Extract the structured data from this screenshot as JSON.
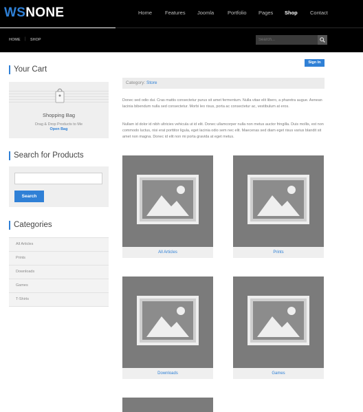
{
  "brand": {
    "part1": "WS",
    "part2": "NONE",
    "accent": "#2f80d6"
  },
  "nav": {
    "items": [
      "Home",
      "Features",
      "Joomla",
      "Portfolio",
      "Pages",
      "Shop",
      "Contact"
    ],
    "active": "Shop"
  },
  "breadcrumb": {
    "home": "HOME",
    "current": "SHOP"
  },
  "top_search": {
    "placeholder": "Search...",
    "icon": "search-icon"
  },
  "sidebar": {
    "cart": {
      "heading": "Your Cart",
      "icon": "shopping-bag-icon",
      "title": "Shopping Bag",
      "subtitle": "Drag & Drop Products to Me",
      "link": "Open Bag"
    },
    "search": {
      "heading": "Search for Products",
      "value": "",
      "button": "Search"
    },
    "categories": {
      "heading": "Categories",
      "items": [
        "All Articles",
        "Prints",
        "Downloads",
        "Games",
        "T-Shirts"
      ]
    }
  },
  "main": {
    "signin": "Sign In",
    "category_label": "Category:",
    "category_value": "Store",
    "paragraph1": "Donec sed odio dui. Cras mattis consectetur purus sit amet fermentum. Nulla vitae elit libero, a pharetra augue. Aenean lacinia bibendum nulla sed consectetur. Morbi leo risus, porta ac consectetur ac, vestibulum at eros.",
    "paragraph2": "Nullam id dolor id nibh ultricies vehicula ut id elit. Donec ullamcorper nulla non metus auctor fringilla. Duis mollis, est non commodo luctus, nisi erat porttitor ligula, eget lacinia odio sem nec elit. Maecenas sed diam eget risus varius blandit sit amet non magna. Donec id elit non mi porta gravida at eget metus.",
    "products": [
      {
        "label": "All Articles",
        "icon": "image-placeholder-icon"
      },
      {
        "label": "Prints",
        "icon": "image-placeholder-icon"
      },
      {
        "label": "Downloads",
        "icon": "image-placeholder-icon"
      },
      {
        "label": "Games",
        "icon": "image-placeholder-icon"
      },
      {
        "label": "",
        "icon": "image-placeholder-icon"
      }
    ]
  }
}
